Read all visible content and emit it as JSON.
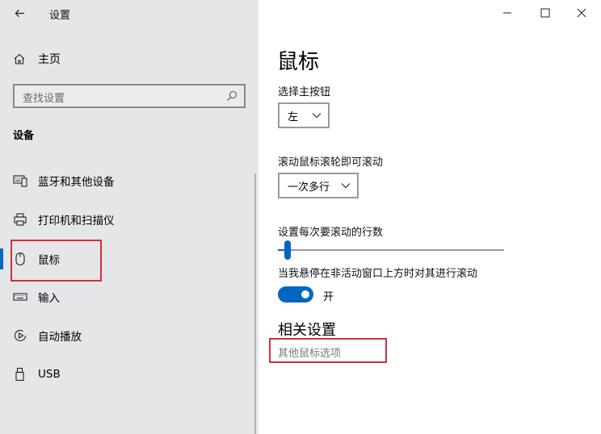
{
  "window": {
    "title": "设置",
    "back_icon": "back-arrow-icon",
    "controls": [
      "minimize-icon",
      "maximize-icon",
      "close-icon"
    ]
  },
  "sidebar": {
    "home_label": "主页",
    "search_placeholder": "查找设置",
    "section_title": "设备",
    "items": [
      {
        "label": "蓝牙和其他设备",
        "icon": "bluetooth-devices-icon"
      },
      {
        "label": "打印机和扫描仪",
        "icon": "printer-icon"
      },
      {
        "label": "鼠标",
        "icon": "mouse-icon",
        "selected": true
      },
      {
        "label": "输入",
        "icon": "keyboard-icon"
      },
      {
        "label": "自动播放",
        "icon": "autoplay-icon"
      },
      {
        "label": "USB",
        "icon": "usb-icon"
      }
    ]
  },
  "main": {
    "title": "鼠标",
    "primary_button": {
      "label": "选择主按钮",
      "value": "左"
    },
    "wheel_scroll": {
      "label": "滚动鼠标滚轮即可滚动",
      "value": "一次多行"
    },
    "lines_to_scroll": {
      "label": "设置每次要滚动的行数",
      "level_fraction": 0.03
    },
    "inactive_scroll": {
      "label": "当我悬停在非活动窗口上方时对其进行滚动",
      "state": "开",
      "on": true
    },
    "related_title": "相关设置",
    "related_link": "其他鼠标选项"
  },
  "colors": {
    "accent": "#0067c0",
    "highlight_box": "#d0303a",
    "sidebar_bg": "#e4e6e8"
  }
}
